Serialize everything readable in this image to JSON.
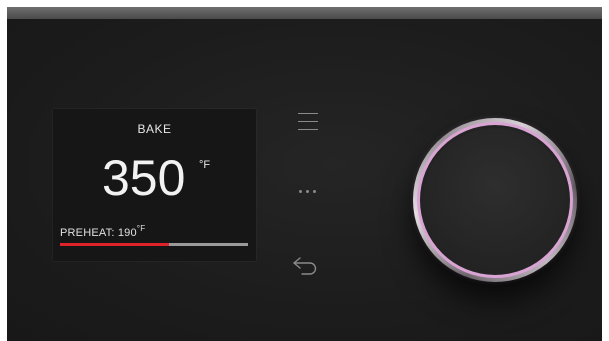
{
  "display": {
    "mode": "BAKE",
    "set_temp": "350",
    "set_temp_unit": "°F",
    "preheat_label": "PREHEAT: 190",
    "preheat_unit": "°F",
    "preheat_progress_fraction": 0.58,
    "progress_color": "#e0232a",
    "track_color": "#9a9a9a"
  },
  "controls": {
    "menu_icon": "menu-icon",
    "more_icon": "more-icon",
    "back_icon": "back-icon",
    "knob_ring_color": "#d9a4d3"
  }
}
